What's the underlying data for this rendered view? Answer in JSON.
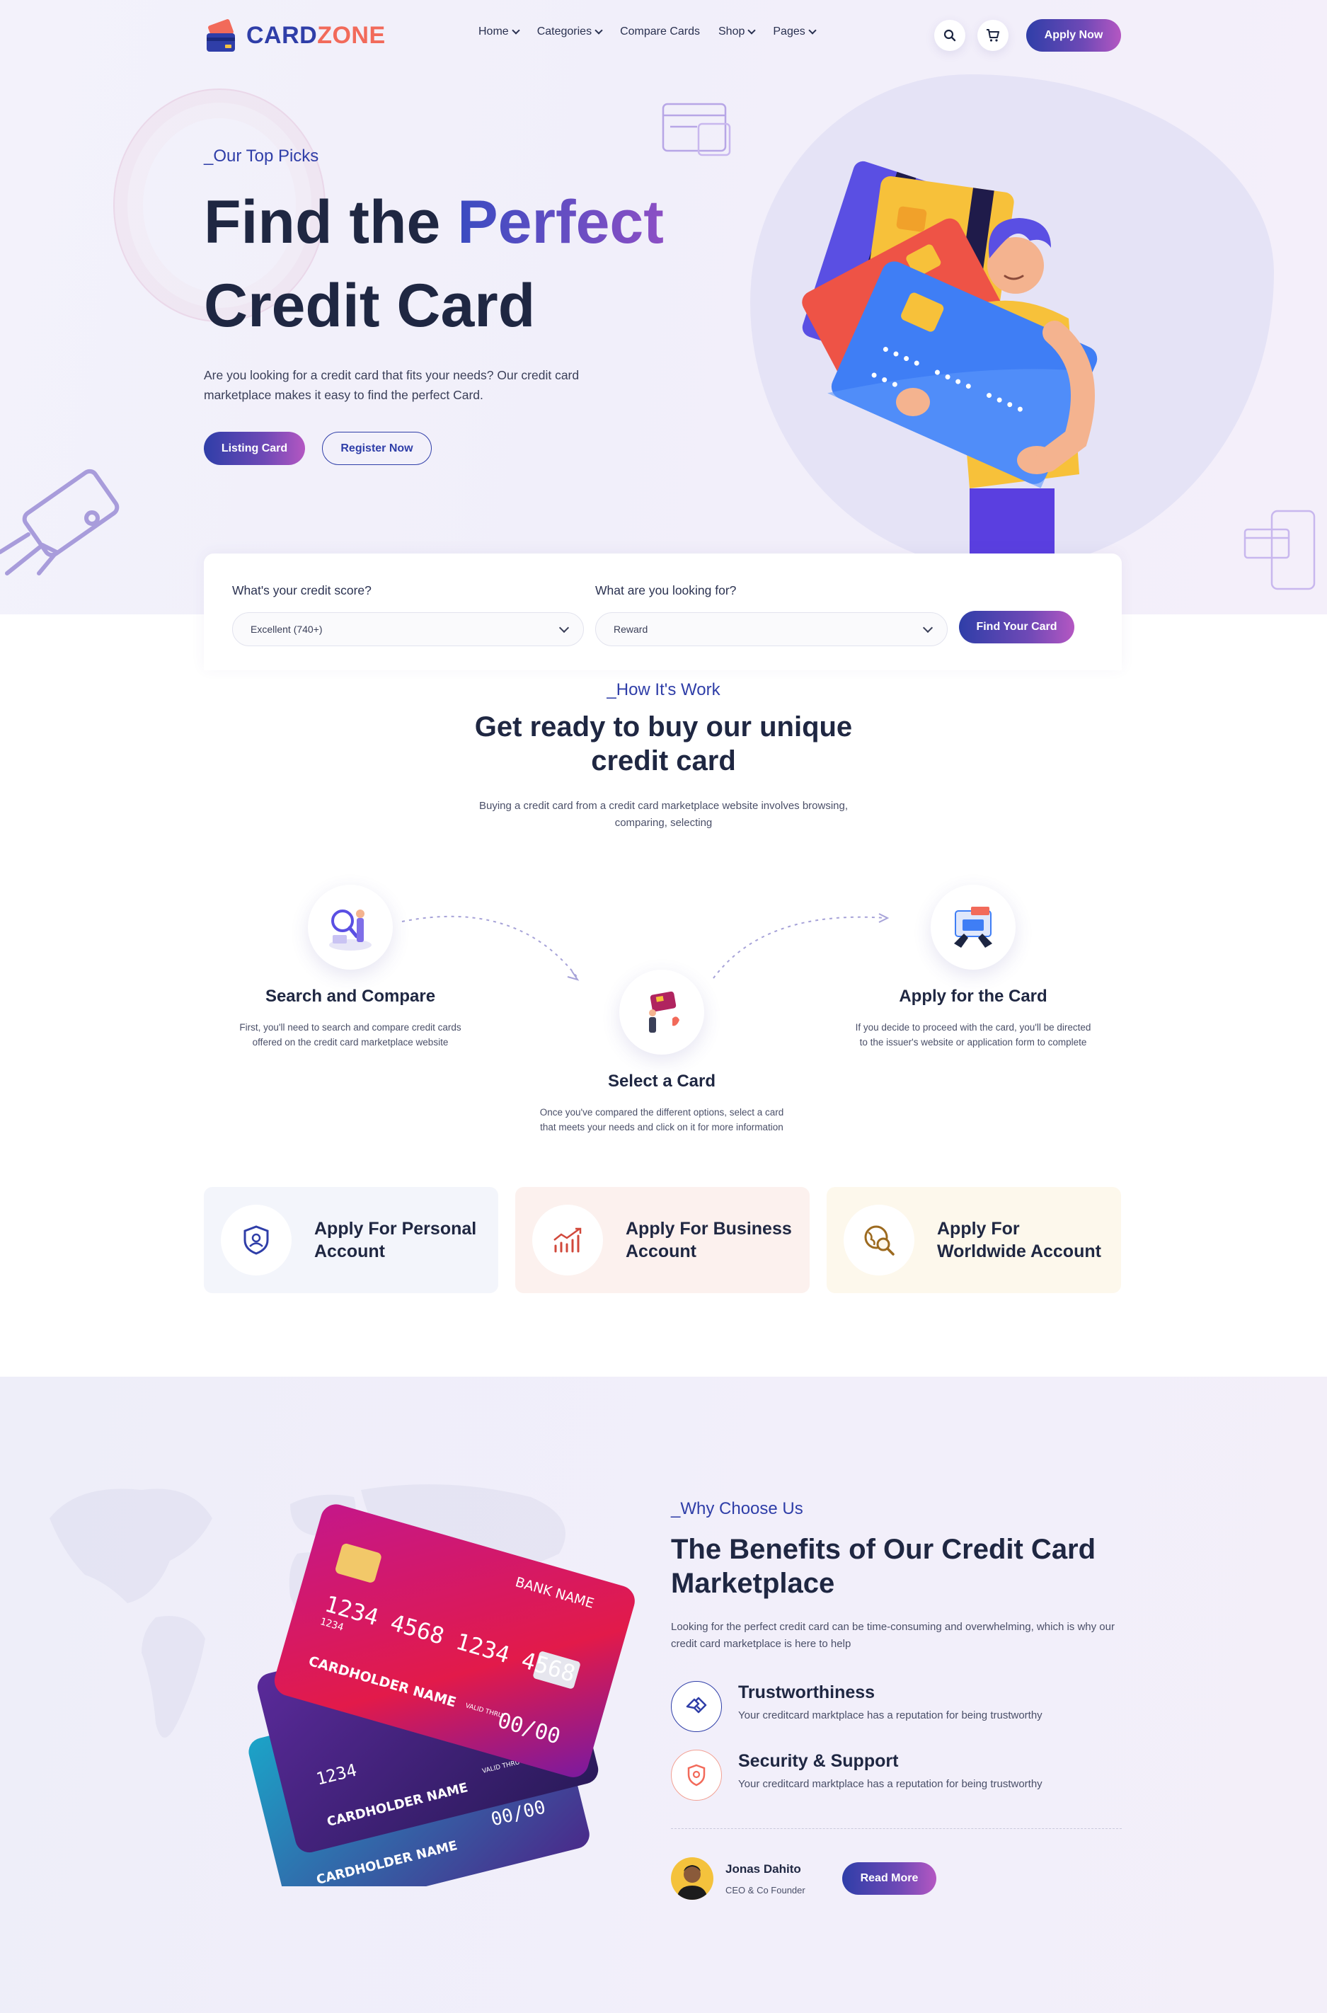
{
  "brand": {
    "name_part1": "CARD",
    "name_part2": "ZONE"
  },
  "nav": {
    "items": [
      {
        "label": "Home",
        "dropdown": true
      },
      {
        "label": "Categories",
        "dropdown": true
      },
      {
        "label": "Compare Cards",
        "dropdown": false
      },
      {
        "label": "Shop",
        "dropdown": true
      },
      {
        "label": "Pages",
        "dropdown": true
      }
    ],
    "apply_label": "Apply Now"
  },
  "hero": {
    "tag": "_Our Top Picks",
    "title_part1": "Find the ",
    "title_highlight": "Perfect",
    "title_part2": "Credit Card",
    "description": "Are you looking for a credit card that fits your needs? Our credit card marketplace makes it easy to find the perfect Card.",
    "primary_button": "Listing Card",
    "secondary_button": "Register Now"
  },
  "search": {
    "score_label": "What's your credit score?",
    "score_value": "Excellent (740+)",
    "looking_label": "What are you looking for?",
    "looking_value": "Reward",
    "button": "Find Your Card"
  },
  "how": {
    "tag": "_How It's Work",
    "title_line1": "Get ready to buy our unique",
    "title_line2": "credit card",
    "desc_line1": "Buying a credit card from a credit card marketplace website involves browsing,",
    "desc_line2": "comparing, selecting",
    "steps": [
      {
        "title": "Search and Compare",
        "desc_line1": "First, you'll need to search and compare credit cards",
        "desc_line2": "offered on the credit card marketplace website"
      },
      {
        "title": "Select a Card",
        "desc_line1": "Once you've compared the different options, select a card",
        "desc_line2": "that meets your needs and click on it for more information"
      },
      {
        "title": "Apply for the Card",
        "desc_line1": "If you decide to proceed with the card, you'll be directed",
        "desc_line2": "to the issuer's website or application form to complete"
      }
    ]
  },
  "accounts": [
    {
      "label": "Apply For Personal Account",
      "icon": "shield-user-icon",
      "bg": "#f3f5fb"
    },
    {
      "label": "Apply For Business Account",
      "icon": "chart-icon",
      "bg": "#fcf1ee"
    },
    {
      "label": "Apply For Worldwide Account",
      "icon": "globe-search-icon",
      "bg": "#fdf8ec"
    }
  ],
  "why": {
    "tag": "_Why Choose Us",
    "title": "The Benefits of Our Credit Card Marketplace",
    "description": "Looking for the perfect credit card can be time-consuming and overwhelming, which is why our credit card marketplace is here to help",
    "features": [
      {
        "title": "Trustworthiness",
        "desc": "Your creditcard marktplace has a reputation for being trustworthy",
        "icon": "handshake-icon"
      },
      {
        "title": "Security & Support",
        "desc": "Your creditcard marktplace has a reputation for being trustworthy",
        "icon": "shield-icon"
      }
    ],
    "author": {
      "name": "Jonas Dahito",
      "role": "CEO & Co Founder"
    },
    "button": "Read More"
  },
  "cards_text": {
    "bank_name": "BANK NAME",
    "number": "1234  4568  1234  4568",
    "small_number": "1234",
    "holder": "CARDHOLDER NAME",
    "valid_thru": "VALID THRU",
    "expiry": "00/00"
  },
  "colors": {
    "primary": "#2f3ea8",
    "accent": "#f26a5a",
    "gradient_end": "#b457c2"
  }
}
